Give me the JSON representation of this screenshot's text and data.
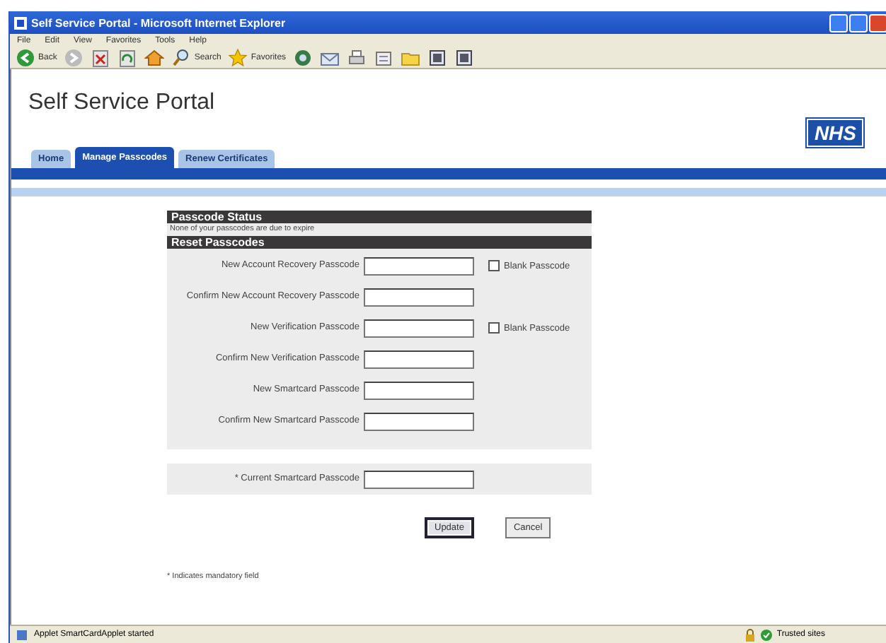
{
  "window": {
    "title": "Self Service Portal - Microsoft Internet Explorer"
  },
  "menu": [
    "File",
    "Edit",
    "View",
    "Favorites",
    "Tools",
    "Help"
  ],
  "toolbar": [
    {
      "kind": "back",
      "label": "Back"
    },
    {
      "kind": "forward"
    },
    {
      "kind": "stop"
    },
    {
      "kind": "refresh"
    },
    {
      "kind": "home"
    },
    {
      "kind": "search",
      "label": "Search"
    },
    {
      "kind": "favorites",
      "label": "Favorites"
    },
    {
      "kind": "media"
    },
    {
      "kind": "mail"
    },
    {
      "kind": "print"
    },
    {
      "kind": "edit"
    },
    {
      "kind": "folder"
    },
    {
      "kind": "tool"
    },
    {
      "kind": "tool"
    }
  ],
  "page": {
    "title": "Self Service Portal",
    "logo": "NHS",
    "tabs": [
      {
        "label": "Home",
        "selected": false
      },
      {
        "label": "Manage Passcodes",
        "selected": true
      },
      {
        "label": "Renew Certificates",
        "selected": false
      }
    ]
  },
  "status_section": {
    "heading": "Passcode Status",
    "message": "None of your passcodes are due to expire"
  },
  "reset_section": {
    "heading": "Reset Passcodes",
    "fields": [
      {
        "label": "New Account Recovery Passcode",
        "blank_option": "Blank Passcode",
        "checked": false
      },
      {
        "label": "Confirm New Account Recovery Passcode"
      },
      {
        "label": "New Verification Passcode",
        "blank_option": "Blank Passcode",
        "checked": false
      },
      {
        "label": "Confirm New Verification Passcode"
      },
      {
        "label": "New Smartcard Passcode"
      },
      {
        "label": "Confirm New Smartcard Passcode"
      }
    ]
  },
  "current_passcode": {
    "label": "* Current Smartcard Passcode"
  },
  "buttons": [
    {
      "label": "Update",
      "default": true
    },
    {
      "label": "Cancel",
      "default": false
    }
  ],
  "footnote": "* Indicates mandatory field",
  "status_bar": {
    "text": "Applet SmartCardApplet started",
    "zone": "Trusted sites"
  }
}
